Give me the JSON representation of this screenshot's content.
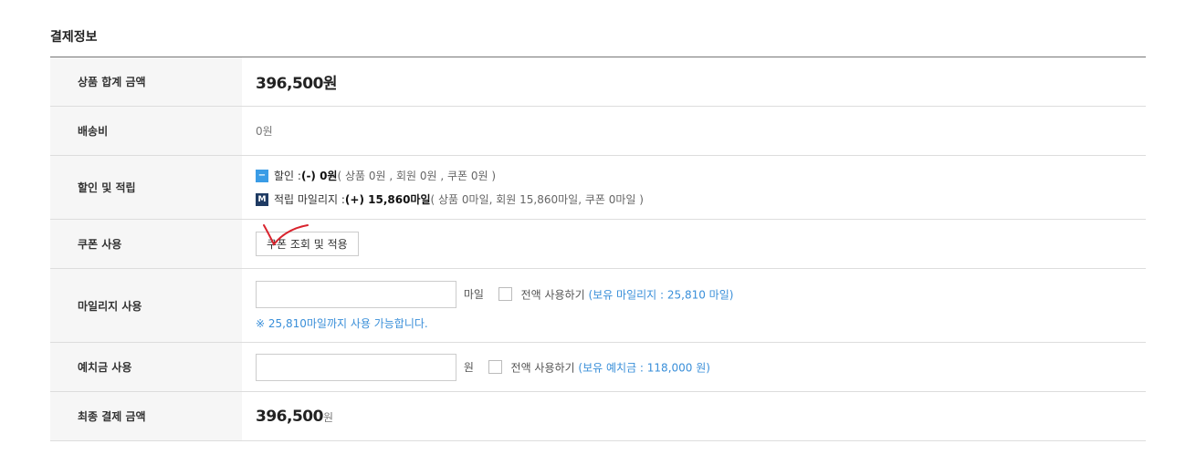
{
  "section_title": "결제정보",
  "rows": {
    "product_total": {
      "label": "상품 합계 금액",
      "value": "396,500원"
    },
    "shipping": {
      "label": "배송비",
      "value": "0원"
    },
    "discount": {
      "label": "할인 및 적립",
      "discount_prefix": "할인 : ",
      "discount_amount": "(-) 0원",
      "discount_detail": " ( 상품 0원 , 회원 0원 , 쿠폰 0원 )",
      "mileage_prefix": "적립 마일리지 : ",
      "mileage_amount": "(+) 15,860마일",
      "mileage_detail": " ( 상품 0마일, 회원 15,860마일, 쿠폰 0마일 )",
      "minus_badge": "−",
      "m_badge": "M"
    },
    "coupon": {
      "label": "쿠폰 사용",
      "button": "쿠폰 조회 및 적용"
    },
    "mileage": {
      "label": "마일리지 사용",
      "input_value": "",
      "unit": "마일",
      "use_all": "전액 사용하기",
      "holding": "(보유 마일리지 : 25,810 마일)",
      "note": "※ 25,810마일까지 사용 가능합니다."
    },
    "deposit": {
      "label": "예치금 사용",
      "input_value": "",
      "unit": "원",
      "use_all": "전액 사용하기",
      "holding": "(보유 예치금 : 118,000 원)"
    },
    "final": {
      "label": "최종 결제 금액",
      "value": "396,500",
      "unit": "원"
    }
  },
  "colors": {
    "accent": "#3a8fd9",
    "scribble": "#d9232d"
  },
  "icons": {
    "check_mark": "red-checkmark-annotation"
  }
}
